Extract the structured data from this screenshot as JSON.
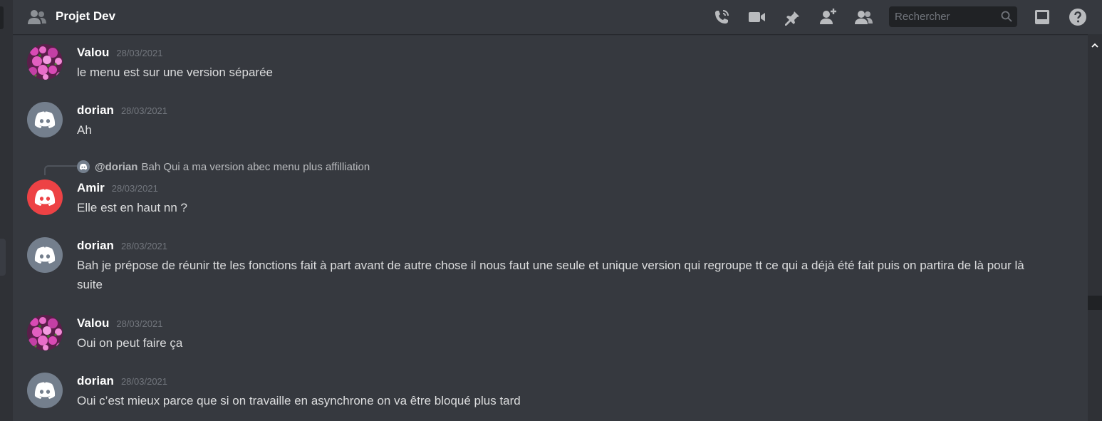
{
  "header": {
    "channel_icon": "people-icon",
    "channel_name": "Projet Dev",
    "tools": [
      "call-icon",
      "video-icon",
      "pin-icon",
      "add-member-icon",
      "members-icon"
    ],
    "search_placeholder": "Rechercher",
    "right_icons": [
      "inbox-icon",
      "help-icon"
    ]
  },
  "messages": [
    {
      "author": "Valou",
      "timestamp": "28/03/2021",
      "avatar": "flower",
      "text": "le menu est sur une version séparée"
    },
    {
      "author": "dorian",
      "timestamp": "28/03/2021",
      "avatar": "discord-grey",
      "text": "Ah"
    },
    {
      "author": "Amir",
      "timestamp": "28/03/2021",
      "avatar": "discord-red",
      "text": "Elle est en haut nn ?",
      "reply": {
        "author": "@dorian",
        "text": "Bah Qui a ma version abec menu plus affilliation"
      }
    },
    {
      "author": "dorian",
      "timestamp": "28/03/2021",
      "avatar": "discord-grey",
      "text": "Bah je prépose de réunir tte les fonctions fait à part avant de autre chose il nous faut une seule et unique version qui regroupe tt ce qui a déjà été fait puis on partira de là pour là suite"
    },
    {
      "author": "Valou",
      "timestamp": "28/03/2021",
      "avatar": "flower",
      "text": "Oui on peut faire ça"
    },
    {
      "author": "dorian",
      "timestamp": "28/03/2021",
      "avatar": "discord-grey",
      "text": "Oui c’est mieux parce que si on travaille en asynchrone on va être bloqué plus tard"
    }
  ],
  "colors": {
    "background": "#36393f",
    "avatar_grey": "#747f8d",
    "avatar_red": "#ed4245",
    "flower": "#c43fa5"
  }
}
